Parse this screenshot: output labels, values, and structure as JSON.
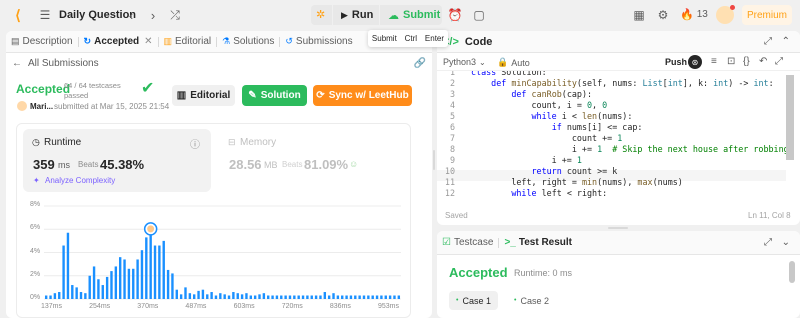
{
  "topbar": {
    "title": "Daily Question",
    "run_label": "Run",
    "submit_label": "Submit",
    "streak_count": "13",
    "premium_label": "Premium",
    "tooltip": {
      "label": "Submit",
      "key1": "Ctrl",
      "key2": "Enter"
    }
  },
  "left_tabs": [
    {
      "label": "Description"
    },
    {
      "label": "Accepted"
    },
    {
      "label": "Editorial"
    },
    {
      "label": "Solutions"
    },
    {
      "label": "Submissions"
    }
  ],
  "submission": {
    "back_label": "All Submissions",
    "status": "Accepted",
    "testcases": "64 / 64 testcases passed",
    "user": "Mari...",
    "submitted": "submitted at Mar 15, 2025 21:54",
    "editorial_btn": "Editorial",
    "solution_btn": "Solution",
    "sync_btn": "Sync w/ LeetHub"
  },
  "stats": {
    "runtime_label": "Runtime",
    "runtime_value": "359",
    "runtime_unit": "ms",
    "beats_label": "Beats",
    "runtime_beats": "45.38%",
    "analyze_label": "Analyze Complexity",
    "memory_label": "Memory",
    "memory_value": "28.56",
    "memory_unit": "MB",
    "memory_beats": "81.09%"
  },
  "chart_data": {
    "type": "bar",
    "ylim": [
      0,
      8
    ],
    "yticks": [
      "8%",
      "6%",
      "4%",
      "2%",
      "0%"
    ],
    "xticks": [
      "137ms",
      "254ms",
      "370ms",
      "487ms",
      "603ms",
      "720ms",
      "836ms",
      "953ms"
    ],
    "values": [
      0.3,
      0.3,
      0.5,
      0.6,
      4.6,
      5.7,
      1.2,
      1.0,
      0.6,
      0.5,
      2.0,
      2.8,
      1.7,
      1.2,
      1.9,
      2.4,
      2.8,
      3.6,
      3.4,
      2.6,
      2.6,
      3.4,
      4.2,
      5.3,
      5.6,
      4.6,
      4.6,
      5.0,
      2.5,
      2.2,
      0.8,
      0.4,
      1.0,
      0.5,
      0.4,
      0.7,
      0.8,
      0.4,
      0.6,
      0.3,
      0.5,
      0.4,
      0.3,
      0.6,
      0.5,
      0.4,
      0.5,
      0.3,
      0.3,
      0.4,
      0.5,
      0.3,
      0.3,
      0.3,
      0.3,
      0.3,
      0.3,
      0.3,
      0.3,
      0.3,
      0.3,
      0.3,
      0.3,
      0.3,
      0.6,
      0.3,
      0.5,
      0.3,
      0.3,
      0.3,
      0.3,
      0.3,
      0.3,
      0.3,
      0.3,
      0.3,
      0.3,
      0.3,
      0.3,
      0.3,
      0.3,
      0.3
    ],
    "highlight_index": 24,
    "bar_color": "#1a90ff"
  },
  "code_panel": {
    "title": "Code",
    "language": "Python3",
    "auto_label": "Auto",
    "push_label": "Push",
    "saved_label": "Saved",
    "cursor_pos": "Ln 11, Col 8",
    "lines": [
      {
        "n": "1",
        "text": "class Solution:"
      },
      {
        "n": "2",
        "text": "    def minCapability(self, nums: List[int], k: int) -> int:"
      },
      {
        "n": "3",
        "text": "        def canRob(cap):"
      },
      {
        "n": "4",
        "text": "            count, i = 0, 0"
      },
      {
        "n": "5",
        "text": "            while i < len(nums):"
      },
      {
        "n": "6",
        "text": "                if nums[i] <= cap:"
      },
      {
        "n": "7",
        "text": "                    count += 1"
      },
      {
        "n": "8",
        "text": "                    i += 1  # Skip the next house after robbing"
      },
      {
        "n": "9",
        "text": "                i += 1"
      },
      {
        "n": "10",
        "text": "            return count >= k"
      },
      {
        "n": "11",
        "text": "        left, right = min(nums), max(nums)"
      },
      {
        "n": "12",
        "text": "        while left < right:"
      }
    ]
  },
  "test_panel": {
    "testcase_tab": "Testcase",
    "result_tab": "Test Result",
    "status": "Accepted",
    "runtime": "Runtime: 0 ms",
    "case1": "Case 1",
    "case2": "Case 2"
  }
}
